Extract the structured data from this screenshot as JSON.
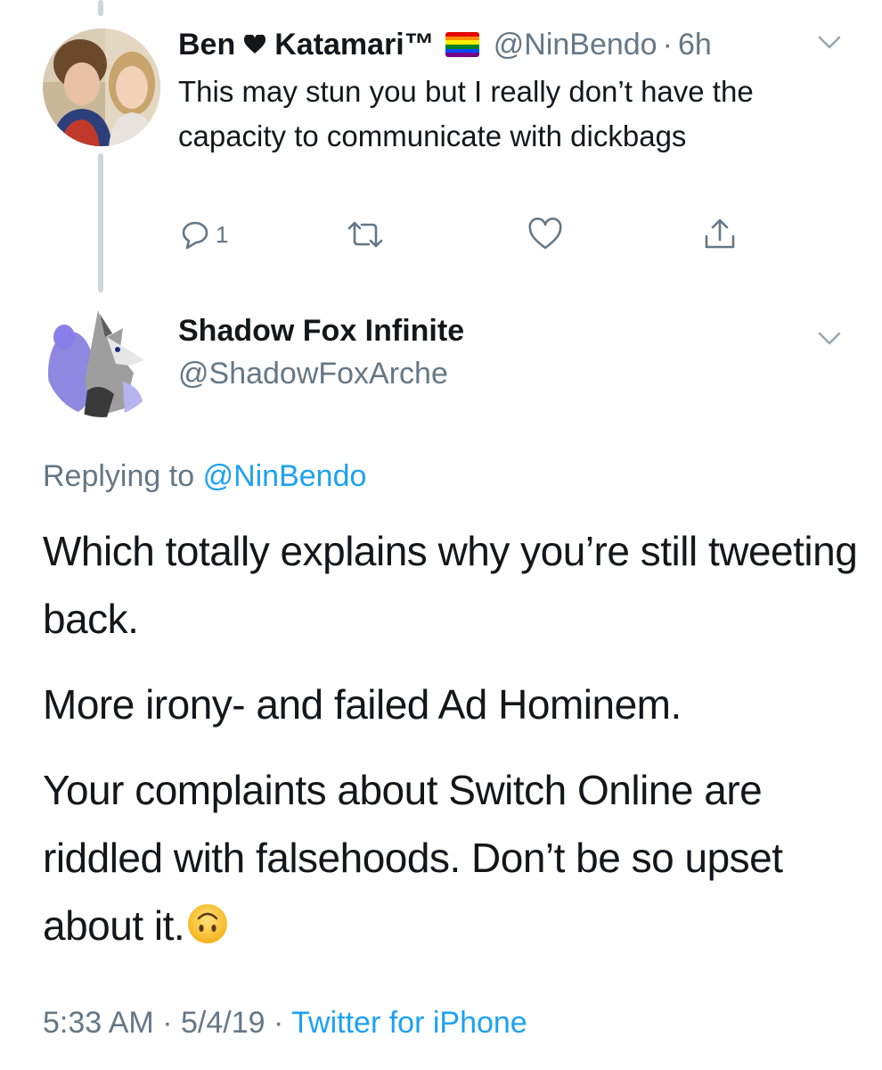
{
  "tweet_parent": {
    "display_name_part1": "Ben",
    "display_name_part2": "Katamari™",
    "handle": "@NinBendo",
    "separator": "·",
    "time": "6h",
    "text": "This may stun you but I really don’t have the capacity to communicate with dickbags",
    "reply_count": "1",
    "icons": {
      "reply": "reply-icon",
      "retweet": "retweet-icon",
      "like": "heart-icon",
      "share": "share-icon",
      "menu": "chevron-down-icon",
      "name_heart": "black-heart-icon",
      "flag": "rainbow-flag-icon"
    }
  },
  "tweet_main": {
    "display_name": "Shadow Fox Infinite",
    "handle": "@ShadowFoxArche",
    "replying_prefix": "Replying to",
    "replying_to": "@NinBendo",
    "paragraph1": "Which totally explains why you’re still tweeting back.",
    "paragraph2": "More irony- and failed Ad Hominem.",
    "paragraph3": "Your complaints about Switch Online are riddled with falsehoods.  Don’t be so upset about it.",
    "emoji": "upside-down-face-emoji",
    "time": "5:33 AM",
    "sep1": "·",
    "date": "5/4/19",
    "sep2": "·",
    "source": "Twitter for iPhone"
  },
  "colors": {
    "text": "#14171a",
    "secondary": "#657786",
    "link": "#1da1f2",
    "thread_line": "#ccd6dd"
  }
}
